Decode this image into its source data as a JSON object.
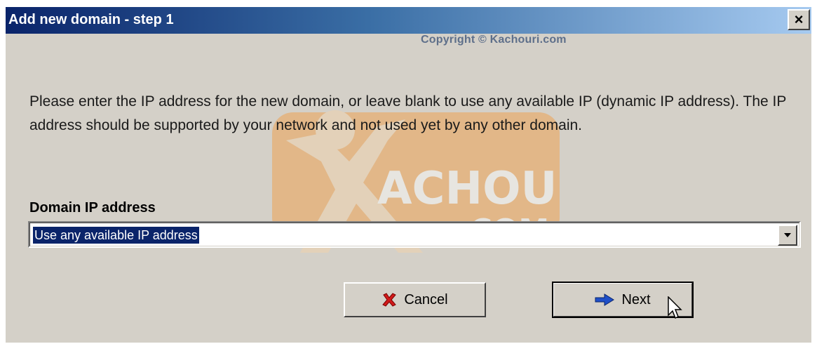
{
  "window": {
    "title": "Add new domain - step 1",
    "close_label": "×",
    "copyright": "Copyright © Kachouri.com"
  },
  "content": {
    "description": "Please enter the IP address for the new domain, or leave blank to use any available IP (dynamic IP address). The IP address should be supported by your network and not used yet by any other domain.",
    "field_label": "Domain IP address",
    "select_value": "Use any available IP address"
  },
  "buttons": {
    "cancel_label": "Cancel",
    "next_label": "Next"
  },
  "watermark": {
    "line1": "ACHOURI",
    "line2": ".COM"
  },
  "colors": {
    "title_gradient_start": "#0a246a",
    "title_gradient_end": "#a6caf0",
    "dialog_bg": "#d4d0c8",
    "selection_bg": "#0a246a",
    "watermark_orange": "#f39a3c"
  },
  "icons": {
    "close": "close-icon",
    "cancel": "red-x-icon",
    "next": "blue-arrow-icon",
    "dropdown": "chevron-down-icon",
    "cursor": "mouse-pointer-icon"
  }
}
